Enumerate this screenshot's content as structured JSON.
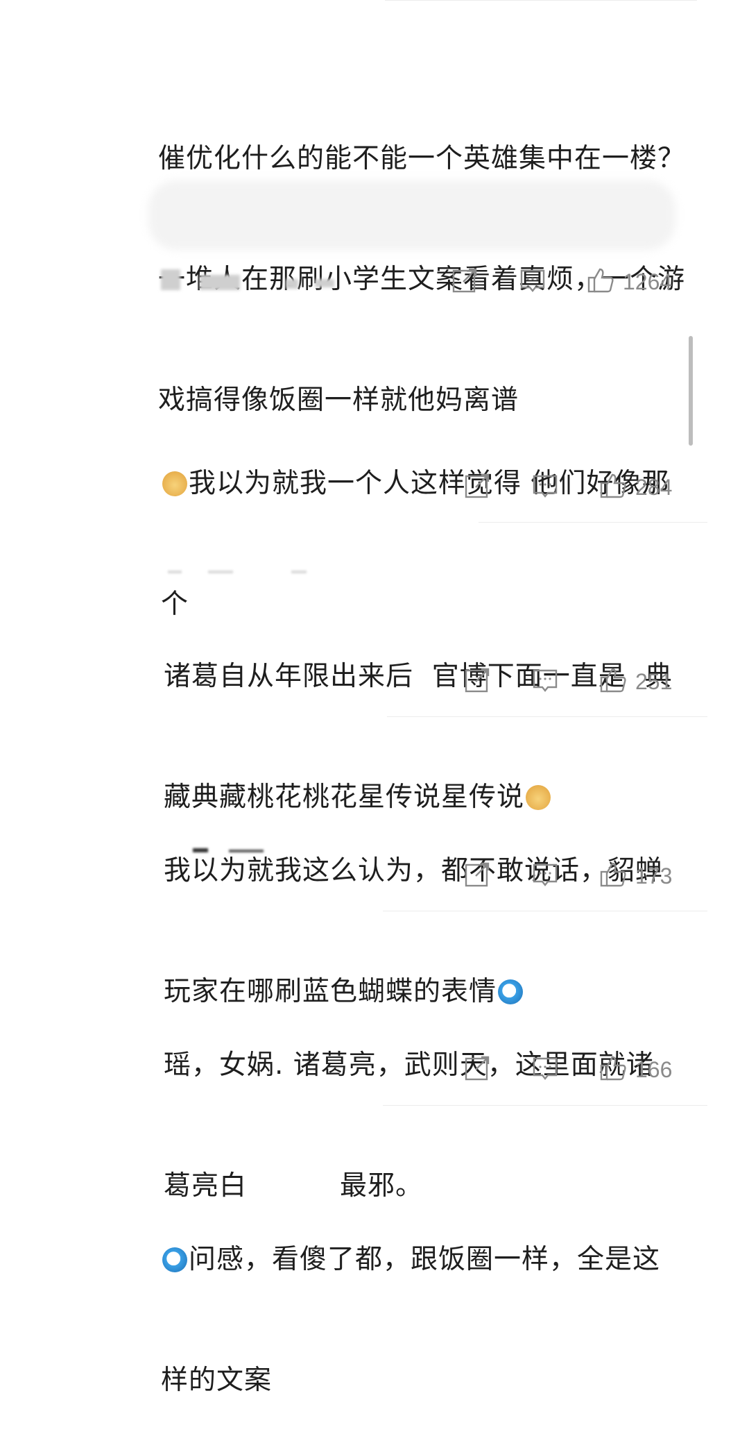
{
  "comments": [
    {
      "text_lines": [
        "催优化什么的能不能一个英雄集中在一楼？",
        "一堆人在那刷小学生文案看着真烦，一个游",
        "戏搞得像饭圈一样就他妈离谱"
      ],
      "likes": "1264"
    },
    {
      "text_after_emoji": "我以为就我一个人这样觉得 他们好像那",
      "line2": "个",
      "likes": "284"
    },
    {
      "text_lines": [
        "诸葛自从年限出来后  官博下面一直是  典",
        "藏典藏桃花桃花星传说星传说"
      ],
      "likes": "251"
    },
    {
      "text_lines": [
        "我以为就我这么认为，都不敢说话，貂蝉",
        "玩家在哪刷蓝色蝴蝶的表情"
      ],
      "likes": "173"
    },
    {
      "text_lines": [
        "瑶，女娲. 诸葛亮，武则天，这里面就诸",
        "葛亮白          最邪。"
      ],
      "likes": "166"
    },
    {
      "text_after_emoji": "问感，看傻了都，跟饭圈一样，全是这",
      "line2": "样的文案"
    }
  ],
  "icons": {
    "share": "share-icon",
    "comment": "comment-icon",
    "like": "thumbs-up-icon"
  },
  "colors": {
    "text": "#1e1e1e",
    "meta": "#8a8a8a",
    "divider": "#ececec"
  }
}
